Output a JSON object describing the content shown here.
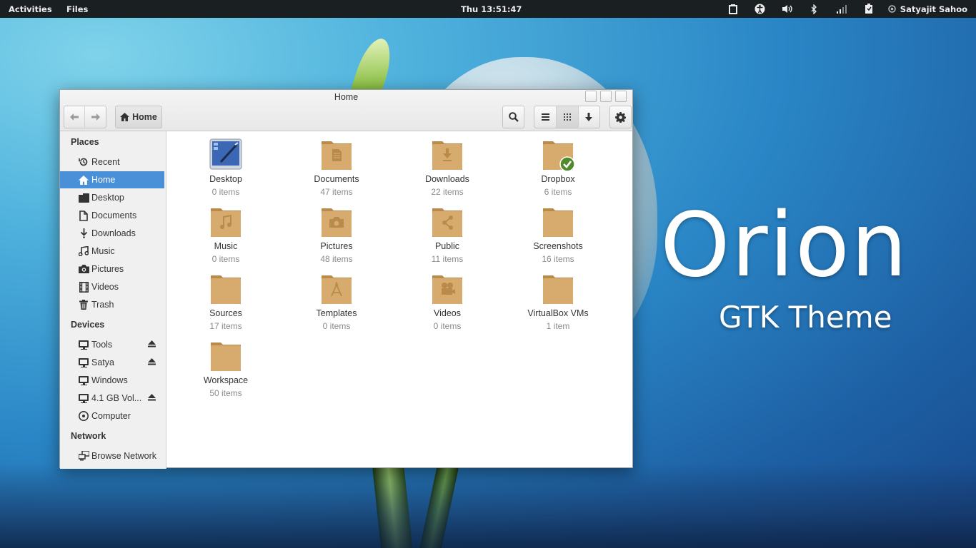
{
  "topbar": {
    "activities": "Activities",
    "app_menu": "Files",
    "clock": "Thu 13:51:47",
    "user": "Satyajit Sahoo"
  },
  "wallpaper": {
    "title": "Orion",
    "subtitle": "GTK Theme"
  },
  "window": {
    "title": "Home",
    "path_button": "Home",
    "sidebar": {
      "places_header": "Places",
      "places": [
        {
          "label": "Recent",
          "icon": "recent-icon"
        },
        {
          "label": "Home",
          "icon": "home-icon"
        },
        {
          "label": "Desktop",
          "icon": "desktop-icon"
        },
        {
          "label": "Documents",
          "icon": "documents-icon"
        },
        {
          "label": "Downloads",
          "icon": "downloads-icon"
        },
        {
          "label": "Music",
          "icon": "music-icon"
        },
        {
          "label": "Pictures",
          "icon": "camera-icon"
        },
        {
          "label": "Videos",
          "icon": "film-icon"
        },
        {
          "label": "Trash",
          "icon": "trash-icon"
        }
      ],
      "devices_header": "Devices",
      "devices": [
        {
          "label": "Tools",
          "icon": "drive-icon",
          "eject": true
        },
        {
          "label": "Satya",
          "icon": "drive-icon",
          "eject": true
        },
        {
          "label": "Windows",
          "icon": "drive-icon",
          "eject": false
        },
        {
          "label": "4.1 GB Vol...",
          "icon": "drive-icon",
          "eject": true
        },
        {
          "label": "Computer",
          "icon": "harddisk-icon",
          "eject": false
        }
      ],
      "network_header": "Network",
      "network": [
        {
          "label": "Browse Network",
          "icon": "network-icon"
        }
      ]
    },
    "files": [
      {
        "name": "Desktop",
        "count": "0 items",
        "emblem": "desktop"
      },
      {
        "name": "Documents",
        "count": "47 items",
        "emblem": "document"
      },
      {
        "name": "Downloads",
        "count": "22 items",
        "emblem": "download"
      },
      {
        "name": "Dropbox",
        "count": "6 items",
        "emblem": "check"
      },
      {
        "name": "Music",
        "count": "0 items",
        "emblem": "music"
      },
      {
        "name": "Pictures",
        "count": "48 items",
        "emblem": "camera"
      },
      {
        "name": "Public",
        "count": "11 items",
        "emblem": "share"
      },
      {
        "name": "Screenshots",
        "count": "16 items",
        "emblem": "none"
      },
      {
        "name": "Sources",
        "count": "17 items",
        "emblem": "none"
      },
      {
        "name": "Templates",
        "count": "0 items",
        "emblem": "compass"
      },
      {
        "name": "Videos",
        "count": "0 items",
        "emblem": "projector"
      },
      {
        "name": "VirtualBox VMs",
        "count": "1 item",
        "emblem": "none"
      },
      {
        "name": "Workspace",
        "count": "50 items",
        "emblem": "none"
      }
    ]
  },
  "colors": {
    "selection": "#4a90d9",
    "folder": "#d2a86b",
    "topbar": "#1a1f22"
  }
}
